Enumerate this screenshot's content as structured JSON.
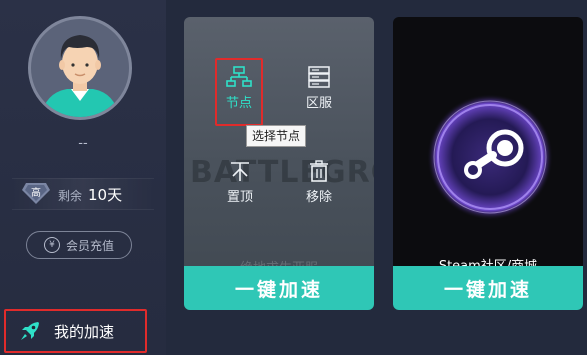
{
  "sidebar": {
    "username": "--",
    "vip_badge": "高",
    "remain_label": "剩余",
    "remain_days": "10天",
    "recharge_icon": "¥",
    "recharge_label": "会员充值",
    "my_speed_label": "我的加速"
  },
  "cards": [
    {
      "name": "绝地求生亚服",
      "bg_text": "BATTLEGROUNDS",
      "boost_label": "一键加速",
      "actions": {
        "node": "节点",
        "server": "区服",
        "pin": "置顶",
        "remove": "移除"
      },
      "tooltip": "选择节点"
    },
    {
      "name": "Steam社区/商城",
      "boost_label": "一键加速"
    }
  ],
  "colors": {
    "accent": "#2fc7b6",
    "highlight": "#e02b2b",
    "node_active": "#2fe0c8"
  }
}
